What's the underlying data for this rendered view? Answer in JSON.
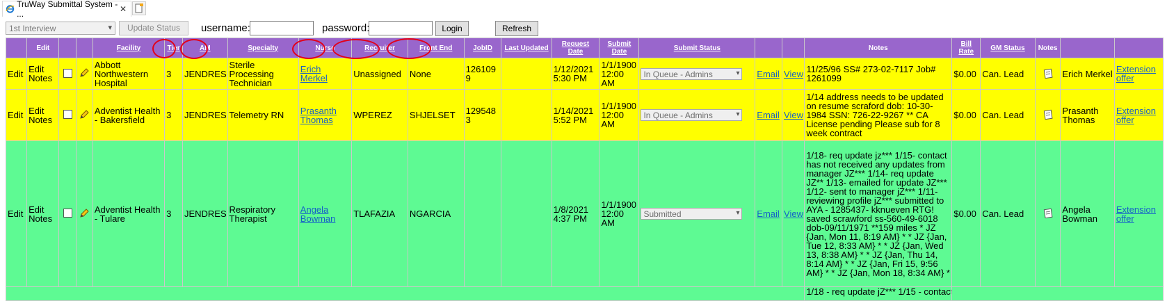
{
  "tab": {
    "title": "TruWay Submittal System - ..."
  },
  "toolbar": {
    "status_select": "1st Interview",
    "update_label": "Update Status",
    "username_label": "username:",
    "password_label": "password:",
    "login_label": "Login",
    "refresh_label": "Refresh"
  },
  "headers": [
    "",
    "Edit",
    "",
    "",
    "Facility",
    "Tier",
    "AM",
    "Specialty",
    "Nurse",
    "Recruiter",
    "Front End",
    "JobID",
    "Last Updated",
    "Request Date",
    "Submit Date",
    "Submit Status",
    "",
    "",
    "Notes",
    "Bill Rate",
    "GM Status",
    "Notes",
    "",
    ""
  ],
  "rows": [
    {
      "edit": "Edit",
      "edit_notes": "Edit Notes",
      "facility": "Abbott Northwestern Hospital",
      "tier": "3",
      "am": "JENDRES",
      "specialty": "Sterile Processing Technician",
      "nurse": "Erich Merkel",
      "recruiter": "Unassigned",
      "front_end": "None",
      "jobid": "126109 9",
      "last_updated": "",
      "request_date": "1/12/2021 5:30 PM",
      "submit_date": "1/1/1900 12:00 AM",
      "submit_status": "In Queue - Admins",
      "email": "Email",
      "view": "View",
      "notes": "11/25/96 SS# 273-02-7117 Job# 1261099",
      "bill_rate": "$0.00",
      "gm_status": "Can. Lead",
      "nurse2": "Erich Merkel",
      "extension": "Extension offer"
    },
    {
      "edit": "Edit",
      "edit_notes": "Edit Notes",
      "facility": "Adventist Health - Bakersfield",
      "tier": "3",
      "am": "JENDRES",
      "specialty": "Telemetry RN",
      "nurse": "Prasanth Thomas",
      "recruiter": "WPEREZ",
      "front_end": "SHJELSET",
      "jobid": "129548 3",
      "last_updated": "",
      "request_date": "1/14/2021 5:52 PM",
      "submit_date": "1/1/1900 12:00 AM",
      "submit_status": "In Queue - Admins",
      "email": "Email",
      "view": "View",
      "notes": "1/14 address needs to be updated on resume scraford dob: 10-30-1984 SSN: 726-22-9267 ** CA License pending Please sub for 8 week contract",
      "bill_rate": "$0.00",
      "gm_status": "Can. Lead",
      "nurse2": "Prasanth Thomas",
      "extension": "Extension offer"
    },
    {
      "edit": "Edit",
      "edit_notes": "Edit Notes",
      "facility": "Adventist Health - Tulare",
      "tier": "3",
      "am": "JENDRES",
      "specialty": "Respiratory Therapist",
      "nurse": "Angela Bowman",
      "recruiter": "TLAFAZIA",
      "front_end": "NGARCIA",
      "jobid": "",
      "last_updated": "",
      "request_date": "1/8/2021 4:37 PM",
      "submit_date": "1/1/1900 12:00 AM",
      "submit_status": "Submitted",
      "email": "Email",
      "view": "View",
      "notes": "1/18- req update jz*** 1/15- contact has not received any updates from manager JZ*** 1/14- req update JZ** 1/13- emailed for update JZ*** 1/12- sent to manager jZ*** 1/11- reviewing profile jZ*** submitted to AYA - 1285437- kknueven RTG! saved scrawford ss-560-49-6018 dob-09/11/1971 **159 miles * JZ {Jan, Mon 11, 8:19 AM} * * JZ {Jan, Tue 12, 8:33 AM} * * JZ {Jan, Wed 13, 8:38 AM} * * JZ {Jan, Thu 14, 8:14 AM} * * JZ {Jan, Fri 15, 9:56 AM} * * JZ {Jan, Mon 18, 8:34 AM} *",
      "bill_rate": "$0.00",
      "gm_status": "Can. Lead",
      "nurse2": "Angela Bowman",
      "extension": "Extension offer"
    }
  ],
  "partial_row": {
    "notes": "1/18 - req update jZ*** 1/15 - contact"
  },
  "colors": {
    "header": "#9966cc",
    "yellow_row": "#ffff00",
    "green_row": "#5efa93",
    "annotation": "#e2001a"
  }
}
